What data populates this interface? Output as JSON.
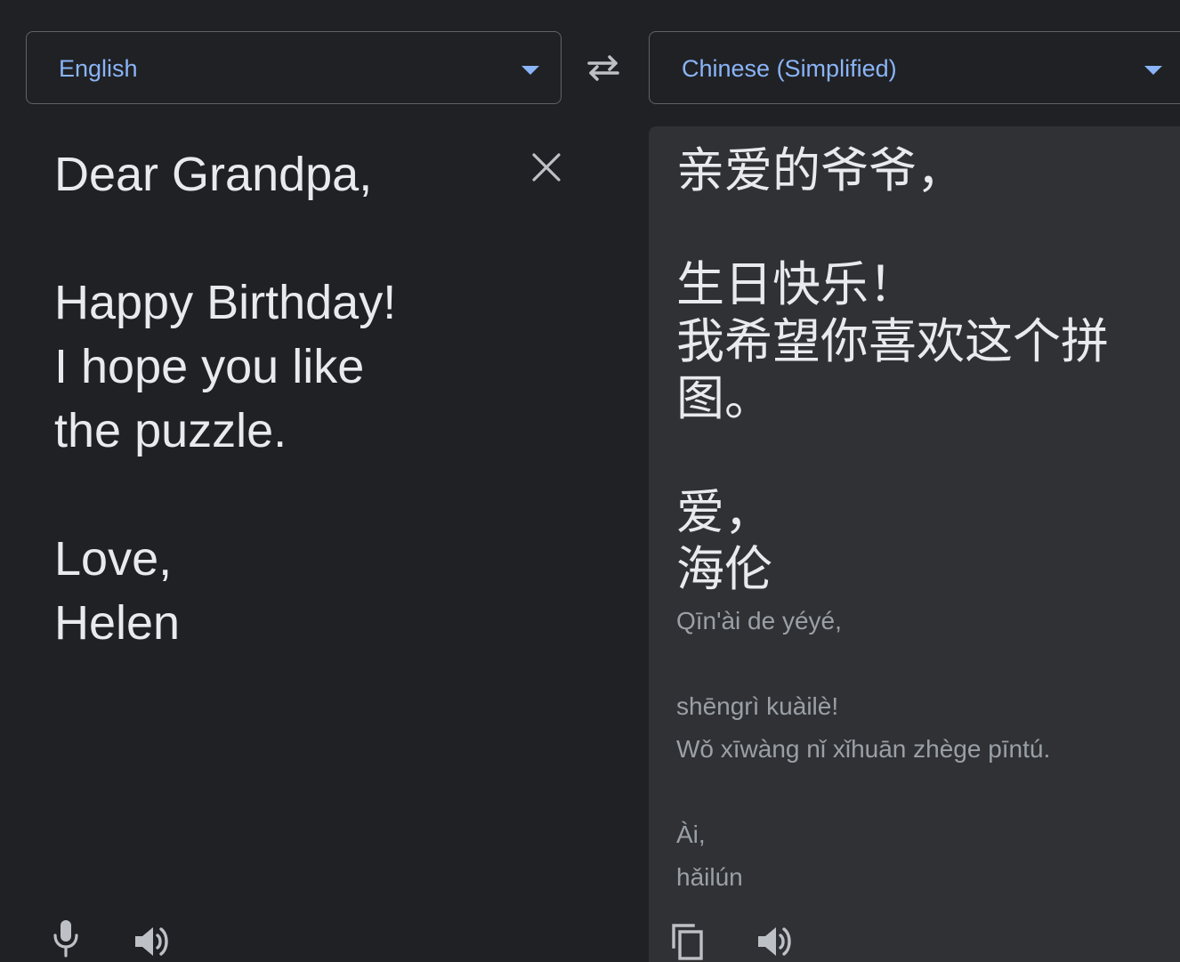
{
  "source_language": {
    "label": "English"
  },
  "target_language": {
    "label": "Chinese (Simplified)"
  },
  "source": {
    "text": "Dear Grandpa,\n\nHappy Birthday!\nI hope you like\nthe puzzle.\n\nLove,\nHelen"
  },
  "target": {
    "text": "亲爱的爷爷，\n\n生日快乐！\n我希望你喜欢这个拼\n图。\n\n爱，\n海伦",
    "romanization": "Qīn'ài de yéyé,\n\nshēngrì kuàilè!\nWǒ xīwàng nǐ xǐhuān zhège pīntú.\n\nÀi,\nhǎilún"
  },
  "icons": {
    "swap": "swap-arrows-icon",
    "clear": "close-icon",
    "mic": "microphone-icon",
    "speaker": "speaker-icon",
    "copy": "copy-icon"
  },
  "colors": {
    "background": "#202124",
    "panel": "#303134",
    "accent": "#8ab4f8",
    "text": "#e8eaed",
    "muted": "#9aa0a6",
    "border": "#5f6368"
  }
}
